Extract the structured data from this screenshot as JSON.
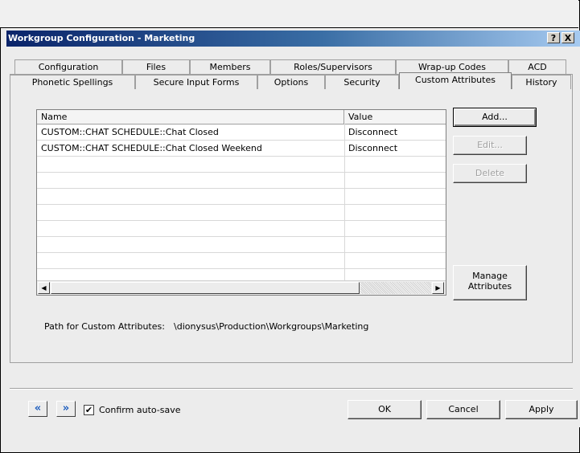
{
  "dialog": {
    "title": "Workgroup Configuration - Marketing",
    "help_glyph": "?",
    "close_glyph": "X"
  },
  "tabs_row1": [
    {
      "label": "Configuration"
    },
    {
      "label": "Files"
    },
    {
      "label": "Members"
    },
    {
      "label": "Roles/Supervisors"
    },
    {
      "label": "Wrap-up Codes"
    },
    {
      "label": "ACD"
    }
  ],
  "tabs_row2": [
    {
      "label": "Phonetic Spellings"
    },
    {
      "label": "Secure Input Forms"
    },
    {
      "label": "Options"
    },
    {
      "label": "Security"
    },
    {
      "label": "Custom Attributes",
      "active": true
    },
    {
      "label": "History"
    }
  ],
  "attributes_table": {
    "columns": [
      "Name",
      "Value"
    ],
    "rows": [
      {
        "name": "CUSTOM::CHAT SCHEDULE::Chat Closed",
        "value": "Disconnect"
      },
      {
        "name": "CUSTOM::CHAT SCHEDULE::Chat Closed Weekend",
        "value": "Disconnect"
      }
    ],
    "scroll_left_glyph": "◀",
    "scroll_right_glyph": "▶"
  },
  "side_buttons": {
    "add": "Add...",
    "edit": "Edit...",
    "delete": "Delete",
    "manage_line1": "Manage",
    "manage_line2": "Attributes"
  },
  "path": {
    "label": "Path for Custom Attributes:",
    "value": "\\dionysus\\Production\\Workgroups\\Marketing"
  },
  "footer": {
    "prev_glyph": "«",
    "next_glyph": "»",
    "confirm_autosave_label": "Confirm auto-save",
    "confirm_autosave_checked": true,
    "check_glyph": "✔",
    "ok": "OK",
    "cancel": "Cancel",
    "apply": "Apply"
  },
  "colors": {
    "titlebar_start": "#0a246a",
    "titlebar_end": "#a6caf0",
    "nav_arrow": "#1f5fbf"
  }
}
